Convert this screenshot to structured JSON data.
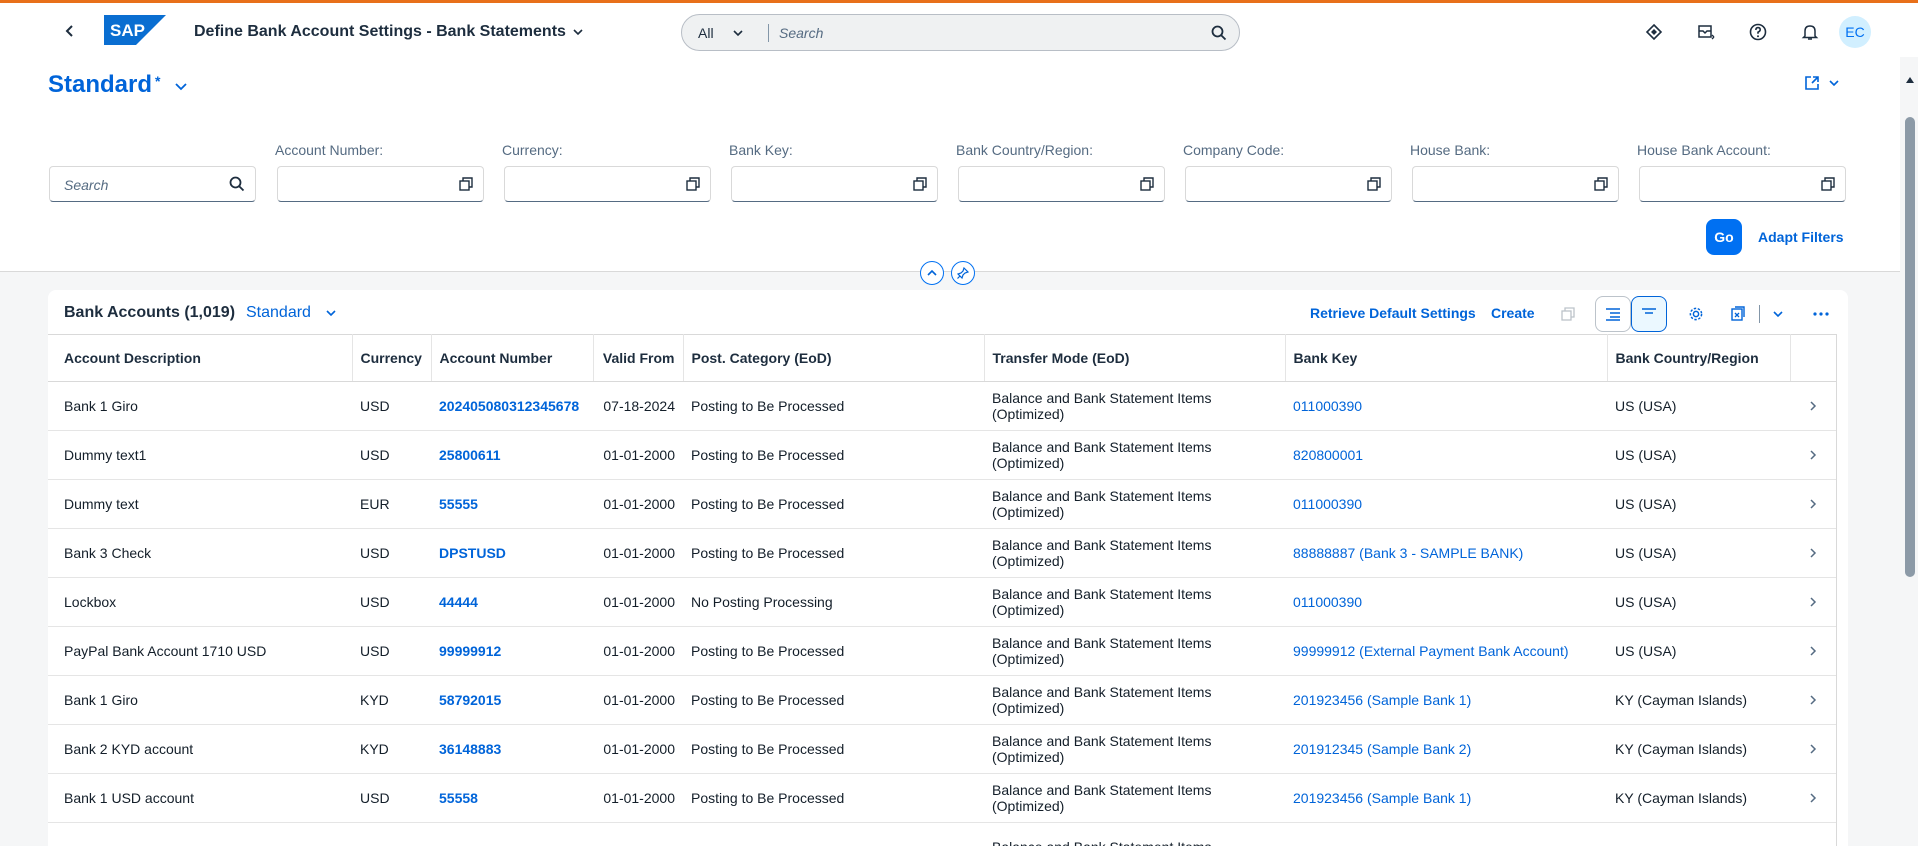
{
  "shell": {
    "title": "Define Bank Account Settings - Bank Statements",
    "search_scope": "All",
    "search_placeholder": "Search",
    "avatar_initials": "EC",
    "accent": "#e8701a",
    "logo_text": "SAP"
  },
  "header": {
    "variant": "Standard",
    "variant_modified": "*",
    "basic_search_placeholder": "Search",
    "filters": [
      {
        "label": "Account Number:"
      },
      {
        "label": "Currency:"
      },
      {
        "label": "Bank Key:"
      },
      {
        "label": "Bank Country/Region:"
      },
      {
        "label": "Company Code:"
      },
      {
        "label": "House Bank:"
      },
      {
        "label": "House Bank Account:"
      }
    ],
    "go_label": "Go",
    "adapt_label": "Adapt Filters"
  },
  "table": {
    "title": "Bank Accounts (1,019)",
    "variant": "Standard",
    "retrieve_label": "Retrieve Default Settings",
    "create_label": "Create",
    "columns": [
      "Account Description",
      "Currency",
      "Account Number",
      "Valid From",
      "Post. Category (EoD)",
      "Transfer Mode (EoD)",
      "Bank Key",
      "Bank Country/Region"
    ],
    "rows": [
      {
        "desc": "Bank 1 Giro",
        "cur": "USD",
        "acct": "202405080312345678",
        "valid": "07-18-2024",
        "post": "Posting to Be Processed",
        "mode": "Balance and Bank Statement Items (Optimized)",
        "bank": "011000390",
        "country": "US (USA)"
      },
      {
        "desc": "Dummy text1",
        "cur": "USD",
        "acct": "25800611",
        "valid": "01-01-2000",
        "post": "Posting to Be Processed",
        "mode": "Balance and Bank Statement Items (Optimized)",
        "bank": "820800001",
        "country": "US (USA)"
      },
      {
        "desc": "Dummy text",
        "cur": "EUR",
        "acct": "55555",
        "valid": "01-01-2000",
        "post": "Posting to Be Processed",
        "mode": "Balance and Bank Statement Items (Optimized)",
        "bank": "011000390",
        "country": "US (USA)"
      },
      {
        "desc": "Bank 3 Check",
        "cur": "USD",
        "acct": "DPSTUSD",
        "valid": "01-01-2000",
        "post": "Posting to Be Processed",
        "mode": "Balance and Bank Statement Items (Optimized)",
        "bank": "88888887 (Bank 3 - SAMPLE BANK)",
        "country": "US (USA)"
      },
      {
        "desc": "Lockbox",
        "cur": "USD",
        "acct": "44444",
        "valid": "01-01-2000",
        "post": "No Posting Processing",
        "mode": "Balance and Bank Statement Items (Optimized)",
        "bank": "011000390",
        "country": "US (USA)"
      },
      {
        "desc": "PayPal Bank Account 1710 USD",
        "cur": "USD",
        "acct": "99999912",
        "valid": "01-01-2000",
        "post": "Posting to Be Processed",
        "mode": "Balance and Bank Statement Items (Optimized)",
        "bank": "99999912 (External Payment Bank Account)",
        "country": "US (USA)"
      },
      {
        "desc": "Bank 1 Giro",
        "cur": "KYD",
        "acct": "58792015",
        "valid": "01-01-2000",
        "post": "Posting to Be Processed",
        "mode": "Balance and Bank Statement Items (Optimized)",
        "bank": "201923456 (Sample Bank 1)",
        "country": "KY (Cayman Islands)"
      },
      {
        "desc": "Bank 2 KYD account",
        "cur": "KYD",
        "acct": "36148883",
        "valid": "01-01-2000",
        "post": "Posting to Be Processed",
        "mode": "Balance and Bank Statement Items (Optimized)",
        "bank": "201912345 (Sample Bank 2)",
        "country": "KY (Cayman Islands)"
      },
      {
        "desc": "Bank 1 USD account",
        "cur": "USD",
        "acct": "55558",
        "valid": "01-01-2000",
        "post": "Posting to Be Processed",
        "mode": "Balance and Bank Statement Items (Optimized)",
        "bank": "201923456 (Sample Bank 1)",
        "country": "KY (Cayman Islands)"
      },
      {
        "desc": "",
        "cur": "",
        "acct": "",
        "valid": "",
        "post": "",
        "mode": "Balance and Bank Statement Items",
        "bank": "",
        "country": ""
      }
    ]
  }
}
